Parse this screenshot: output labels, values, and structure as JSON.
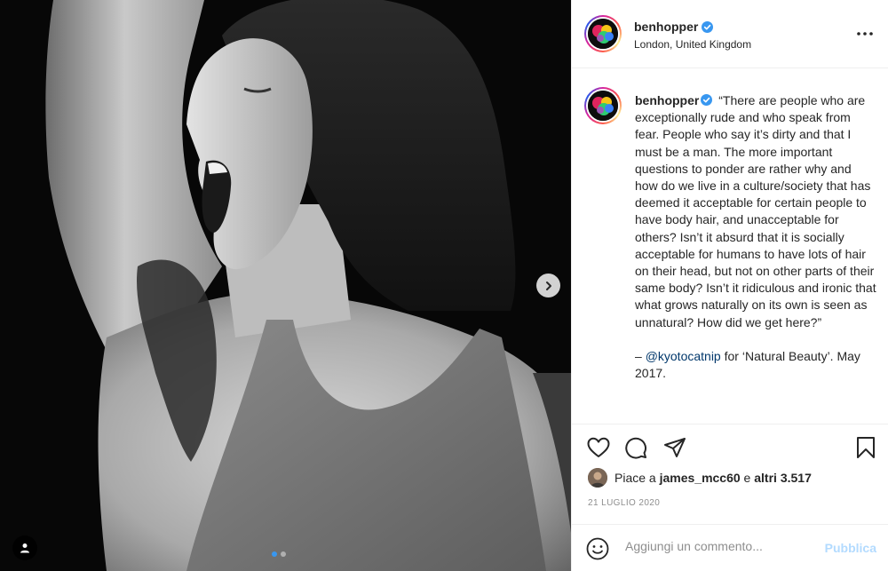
{
  "post": {
    "username": "benhopper",
    "location": "London, United Kingdom",
    "caption": {
      "username": "benhopper",
      "text": "“There are people who are exceptionally rude and who speak from fear. People who say it’s dirty and that I must be a man. The more important questions to ponder are rather why and how do we live in a culture/society that has deemed it acceptable for certain people to have body hair, and unacceptable for others? Isn’t it absurd that it is socially acceptable for humans to have lots of hair on their head, but not on other parts of their same body? Isn’t it ridiculous and ironic that what grows naturally on its own is seen as unnatural? How did we get here?”",
      "credit_dash": "– ",
      "mention": "@kyotocatnip",
      "credit_rest": " for ‘Natural Beauty’. May 2017."
    },
    "likes": {
      "prefix": "Piace a ",
      "user": "james_mcc60",
      "middle": " e ",
      "others": "altri 3.517"
    },
    "date": "21 LUGLIO 2020",
    "comment": {
      "placeholder": "Aggiungi un commento...",
      "publish_label": "Pubblica"
    },
    "carousel": {
      "total": 2,
      "current": 1
    }
  },
  "icons": {
    "verified": "verified-badge-icon",
    "more": "more-options-icon",
    "like": "heart-icon",
    "comment": "comment-bubble-icon",
    "share": "paper-plane-icon",
    "save": "bookmark-icon",
    "emoji": "emoji-smile-icon",
    "next": "chevron-right-icon",
    "tag": "user-tag-icon"
  },
  "colors": {
    "verified": "#3897f0",
    "mention": "#00376b",
    "publish_disabled": "#b3dbff",
    "muted": "#8e8e8e"
  }
}
